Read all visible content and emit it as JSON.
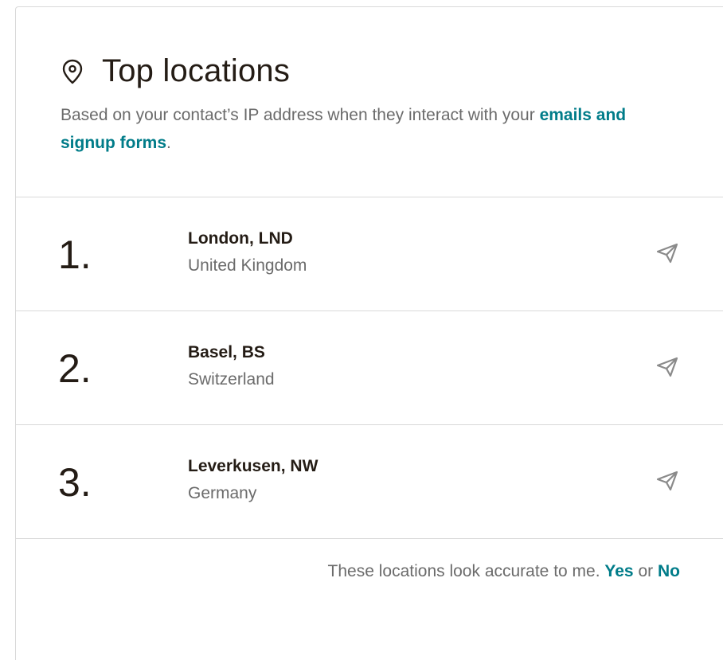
{
  "header": {
    "icon": "map-pin-icon",
    "title": "Top locations",
    "description_prefix": "Based on your contact’s IP address when they interact with your ",
    "description_link": "emails and signup forms",
    "description_suffix": "."
  },
  "locations": [
    {
      "rank": "1.",
      "city": "London, LND",
      "country": "United Kingdom",
      "action_icon": "send-icon"
    },
    {
      "rank": "2.",
      "city": "Basel, BS",
      "country": "Switzerland",
      "action_icon": "send-icon"
    },
    {
      "rank": "3.",
      "city": "Leverkusen, NW",
      "country": "Germany",
      "action_icon": "send-icon"
    }
  ],
  "footer": {
    "prompt": "These locations look accurate to me.",
    "yes": "Yes",
    "or": "or",
    "no": "No"
  },
  "colors": {
    "link": "#007c89",
    "text": "#241c15",
    "muted": "#6b6b6b",
    "border": "#d9d9d9"
  }
}
